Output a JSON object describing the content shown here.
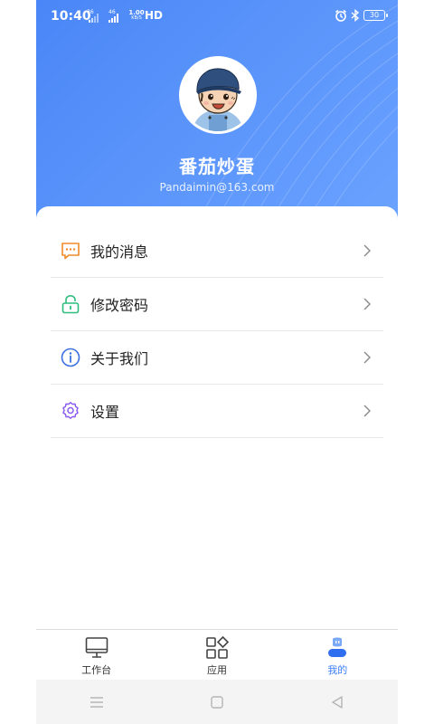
{
  "status_bar": {
    "time": "10:40",
    "net1": "36",
    "net2": "46",
    "speed_value": "1.00",
    "speed_unit": "KB/S",
    "hd": "HD",
    "battery": "30"
  },
  "profile": {
    "name": "番茄炒蛋",
    "email": "Pandaimin@163.com"
  },
  "menu": [
    {
      "label": "我的消息",
      "icon": "message-icon",
      "color": "#f08a28"
    },
    {
      "label": "修改密码",
      "icon": "lock-icon",
      "color": "#2dbd7e"
    },
    {
      "label": "关于我们",
      "icon": "info-icon",
      "color": "#3a6fe0"
    },
    {
      "label": "设置",
      "icon": "gear-icon",
      "color": "#8a5cf0"
    }
  ],
  "tabs": [
    {
      "label": "工作台",
      "icon": "monitor-icon",
      "active": false
    },
    {
      "label": "应用",
      "icon": "apps-icon",
      "active": false
    },
    {
      "label": "我的",
      "icon": "profile-icon",
      "active": true
    }
  ],
  "colors": {
    "header_gradient_start": "#4a86f7",
    "header_gradient_end": "#6aa2ff",
    "active_tab": "#3b7ff5"
  }
}
